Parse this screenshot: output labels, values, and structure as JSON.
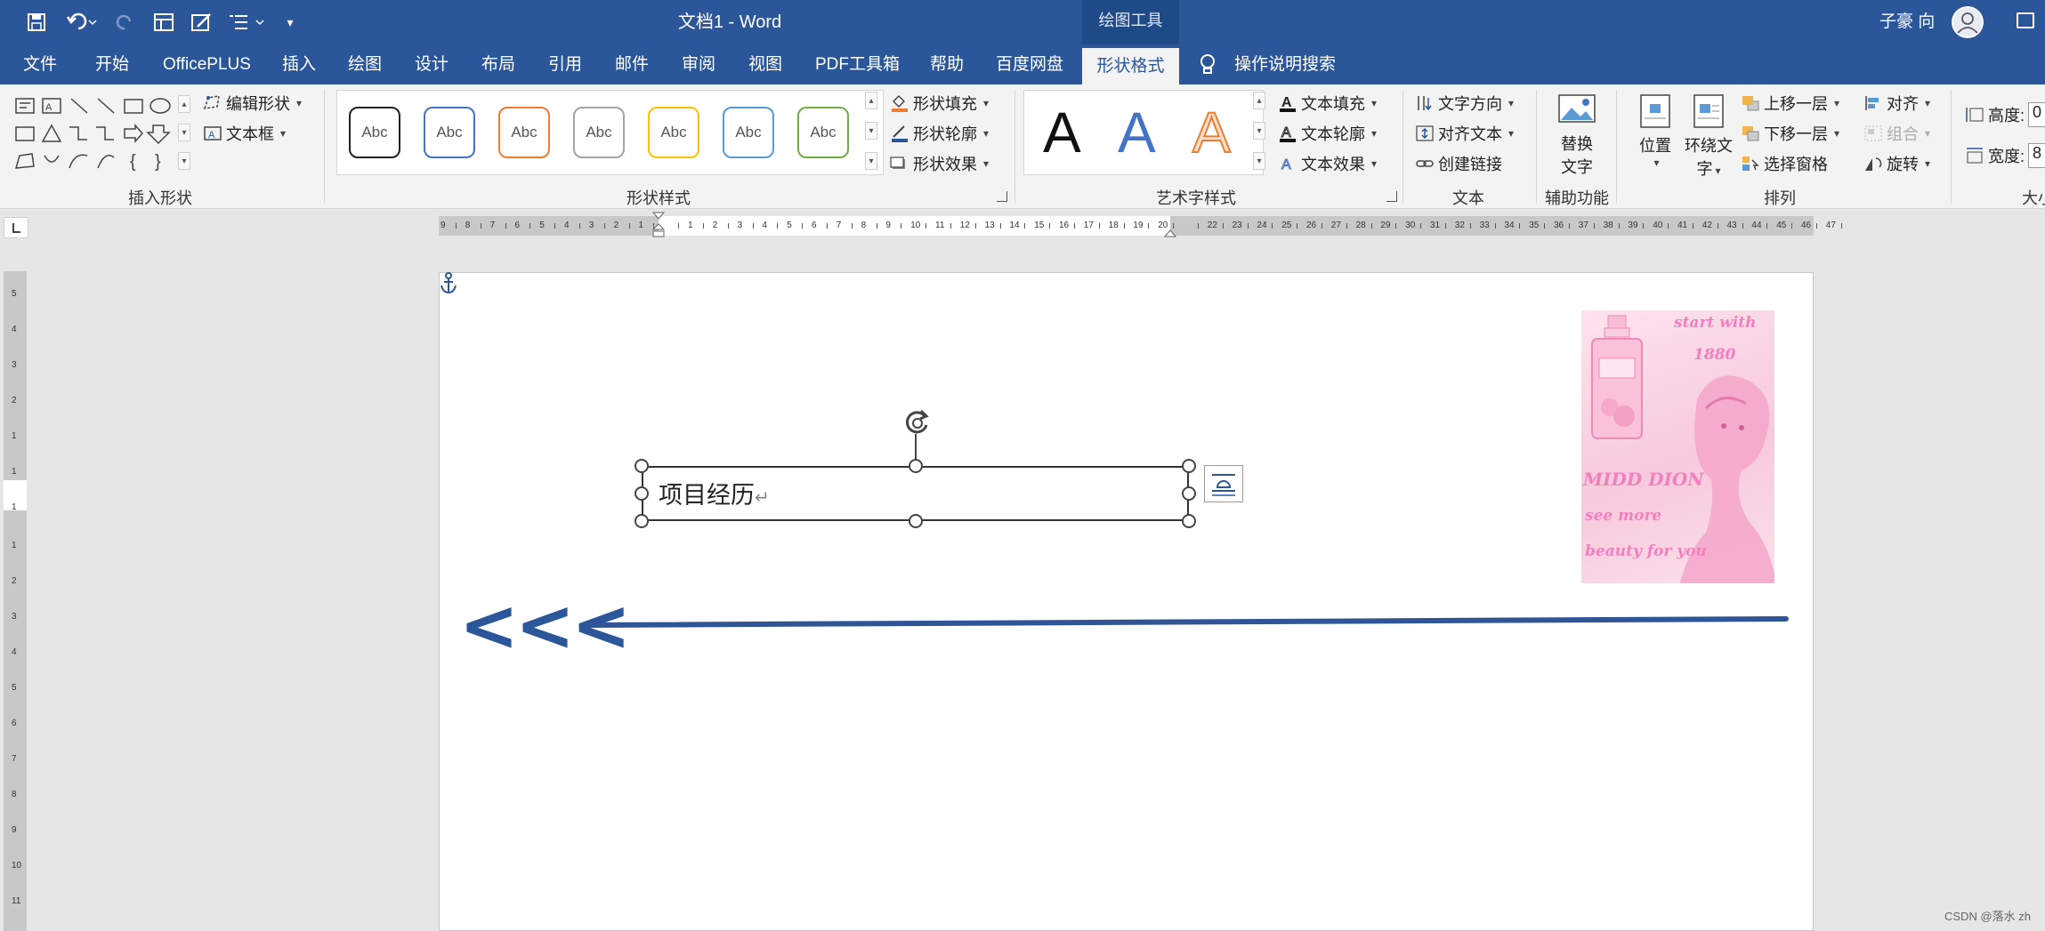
{
  "app": {
    "doc_title": "文档1  -  Word",
    "context_tab": "绘图工具",
    "user_name": "子豪 向"
  },
  "tabs": [
    {
      "label": "文件"
    },
    {
      "label": "开始"
    },
    {
      "label": "OfficePLUS"
    },
    {
      "label": "插入"
    },
    {
      "label": "绘图"
    },
    {
      "label": "设计"
    },
    {
      "label": "布局"
    },
    {
      "label": "引用"
    },
    {
      "label": "邮件"
    },
    {
      "label": "审阅"
    },
    {
      "label": "视图"
    },
    {
      "label": "PDF工具箱"
    },
    {
      "label": "帮助"
    },
    {
      "label": "百度网盘"
    },
    {
      "label": "形状格式"
    }
  ],
  "tell_me": "操作说明搜索",
  "ribbon": {
    "insert_shapes": {
      "label": "插入形状",
      "edit_shape": "编辑形状",
      "text_box": "文本框"
    },
    "shape_styles": {
      "label": "形状样式",
      "sample": "Abc",
      "fill": "形状填充",
      "outline": "形状轮廓",
      "effects": "形状效果",
      "colors": [
        "#222222",
        "#4472c4",
        "#ed7d31",
        "#a5a5a5",
        "#ffc000",
        "#5b9bd5",
        "#70ad47"
      ]
    },
    "wordart": {
      "label": "艺术字样式",
      "letter": "A",
      "text_fill": "文本填充",
      "text_outline": "文本轮廓",
      "text_effects": "文本效果"
    },
    "text": {
      "label": "文本",
      "direction": "文字方向",
      "align": "对齐文本",
      "link": "创建链接"
    },
    "accessibility": {
      "label": "辅助功能",
      "alt_text_1": "替换",
      "alt_text_2": "文字"
    },
    "arrange": {
      "label": "排列",
      "position": "位置",
      "wrap_1": "环绕文",
      "wrap_2": "字",
      "bring_forward": "上移一层",
      "send_backward": "下移一层",
      "selection_pane": "选择窗格",
      "align": "对齐",
      "group": "组合",
      "rotate": "旋转"
    },
    "size": {
      "label": "大小",
      "height": "高度:",
      "height_value": "0",
      "width": "宽度:",
      "width_value": "8"
    }
  },
  "hruler_labels": [
    "9",
    "8",
    "7",
    "6",
    "5",
    "4",
    "3",
    "2",
    "1",
    "",
    "1",
    "2",
    "3",
    "4",
    "5",
    "6",
    "7",
    "8",
    "9",
    "10",
    "11",
    "12",
    "13",
    "14",
    "15",
    "16",
    "17",
    "18",
    "19",
    "20",
    "",
    "22",
    "23",
    "24",
    "25",
    "26",
    "27",
    "28",
    "29",
    "30",
    "31",
    "32",
    "33",
    "34",
    "35",
    "36",
    "37",
    "38",
    "39",
    "40",
    "41",
    "42",
    "43",
    "44",
    "45",
    "46",
    "47"
  ],
  "vruler_labels_top": [
    "5",
    "4",
    "3",
    "2",
    "1",
    "1",
    "1"
  ],
  "vruler_labels_bottom": [
    "1",
    "2",
    "3",
    "4",
    "5",
    "6",
    "7",
    "8",
    "9",
    "10",
    "11",
    "12"
  ],
  "document": {
    "textbox_text": "项目经历",
    "chevrons": "<<<",
    "poster": {
      "line1": "start with",
      "line2": "1880",
      "line3": "MIDD DION",
      "line4": "see more",
      "line5": "beauty for you"
    }
  },
  "watermark": "CSDN @落水 zh"
}
